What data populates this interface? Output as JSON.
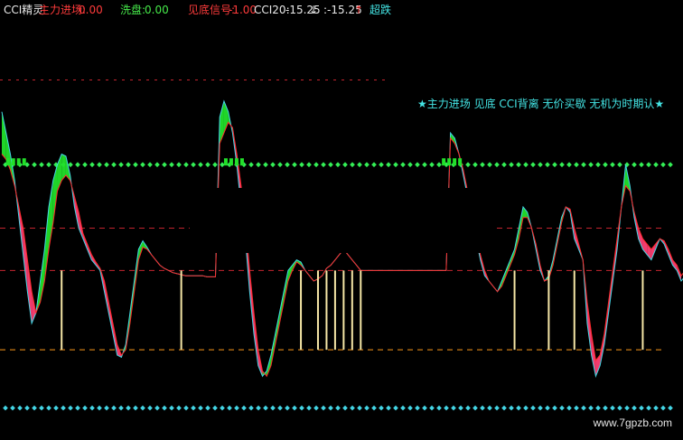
{
  "header": {
    "name": "CCI精灵",
    "main_label": "主力进场:",
    "main_value": "0.00",
    "wash_label": "洗盘:",
    "wash_value": "0.00",
    "bottom_label": "见底信号:",
    "bottom_value": "-1.00",
    "cci_label": "CCI20:",
    "cci_value": "-15.25",
    "cci_arrow": "↓",
    "cci2_value": ":-15.25",
    "cci2_arrow": "↑",
    "oversold": "超跌"
  },
  "banner_text": "★主力进场 见底 CCI背离 无价买歇 无机为时期认★",
  "watermark": "www.7gpzb.com",
  "colors": {
    "background": "#000000",
    "cyan_line": "#44d6e6",
    "red_line": "#ff2a2a",
    "yellow_line": "#f2e28a",
    "up_band": "#ff3f74",
    "down_band": "#22e02a",
    "green_dots": "#33ee55",
    "cyan_dots": "#44d6e6",
    "ref_red": "#c4252f",
    "ref_orange": "#ff9a1a",
    "bars": "#f5e6a6"
  },
  "chart_data": {
    "type": "line",
    "x": [
      0,
      1,
      2,
      3,
      4,
      5,
      6,
      7,
      8,
      9,
      10,
      11,
      12,
      13,
      14,
      15,
      16,
      17,
      18,
      19,
      20,
      21,
      22,
      23,
      24,
      25,
      26,
      27,
      28,
      29,
      30,
      31,
      32,
      33,
      34,
      35,
      36,
      37,
      38,
      39,
      40,
      41,
      42,
      43,
      44,
      45,
      46,
      47,
      48,
      49,
      50,
      51,
      52,
      53,
      54,
      55,
      56,
      57,
      58,
      59,
      60,
      61,
      62,
      63,
      64,
      65,
      66,
      67,
      68,
      69,
      70,
      71,
      72,
      73,
      74,
      75,
      76,
      77,
      78,
      79,
      80,
      81,
      82,
      83,
      84,
      85,
      86,
      87,
      88,
      89,
      90,
      91,
      92,
      93,
      94,
      95,
      96,
      97,
      98,
      99,
      100,
      101,
      102,
      103,
      104,
      105,
      106,
      107,
      108,
      109,
      110,
      111,
      112,
      113,
      114,
      115,
      116,
      117,
      118,
      119,
      120,
      121,
      122,
      123,
      124,
      125,
      126,
      127,
      128,
      129,
      130,
      131,
      132,
      133,
      134,
      135,
      136,
      137,
      138,
      139,
      140,
      141,
      142,
      143,
      144,
      145,
      146,
      147,
      148,
      149,
      150,
      151,
      152,
      153,
      154,
      155,
      156,
      157,
      158,
      159
    ],
    "ylim": [
      -150,
      230
    ],
    "reference_lines": [
      {
        "value": 100,
        "style": "dotted",
        "color": "green"
      },
      {
        "value": 40,
        "style": "dashed",
        "color": "red"
      },
      {
        "value": 0,
        "style": "dashed",
        "color": "red"
      },
      {
        "value": -75,
        "style": "dashed",
        "color": "orange"
      },
      {
        "value": -130,
        "style": "dotted",
        "color": "cyan"
      }
    ],
    "series": [
      {
        "values": [
          150,
          130,
          110,
          85,
          50,
          15,
          -20,
          -50,
          -40,
          -10,
          20,
          60,
          85,
          100,
          110,
          108,
          90,
          60,
          40,
          30,
          20,
          10,
          5,
          0,
          -20,
          -40,
          -60,
          -80,
          -82,
          -70,
          -40,
          -10,
          20,
          28,
          22,
          15,
          10,
          5,
          2,
          0,
          -2,
          -3,
          -4,
          -5,
          -5,
          -5,
          -5,
          -5,
          -6,
          -6,
          -6,
          145,
          160,
          150,
          130,
          100,
          60,
          30,
          -20,
          -60,
          -90,
          -100,
          -95,
          -80,
          -60,
          -40,
          -20,
          0,
          5,
          10,
          8,
          0,
          -5,
          -10,
          -8,
          -5,
          2,
          5,
          10,
          15,
          20,
          15,
          10,
          5,
          0,
          0,
          0,
          0,
          0,
          0,
          0,
          0,
          0,
          0,
          0,
          0,
          0,
          0,
          0,
          0,
          0,
          0,
          0,
          0,
          0,
          130,
          125,
          110,
          90,
          70,
          50,
          30,
          10,
          -5,
          -10,
          -15,
          -20,
          -10,
          0,
          10,
          20,
          40,
          60,
          55,
          40,
          20,
          0,
          -10,
          -5,
          10,
          30,
          50,
          60,
          55,
          30,
          20,
          10,
          -50,
          -80,
          -100,
          -90,
          -70,
          -40,
          -10,
          20,
          60,
          100,
          80,
          50,
          30,
          20,
          15,
          10,
          20,
          30,
          25,
          15,
          5,
          0,
          -10,
          -5,
          0,
          5,
          0,
          -5
        ],
        "color": "cyan_line"
      },
      {
        "values": [
          110,
          105,
          95,
          80,
          60,
          40,
          10,
          -20,
          -40,
          -30,
          -10,
          20,
          45,
          75,
          85,
          90,
          85,
          70,
          55,
          35,
          25,
          15,
          8,
          2,
          -10,
          -30,
          -50,
          -70,
          -80,
          -75,
          -50,
          -20,
          10,
          22,
          20,
          15,
          10,
          5,
          2,
          0,
          -2,
          -3,
          -4,
          -5,
          -5,
          -5,
          -5,
          -5,
          -6,
          -6,
          -6,
          120,
          130,
          140,
          135,
          110,
          80,
          45,
          0,
          -40,
          -75,
          -95,
          -100,
          -90,
          -70,
          -50,
          -30,
          -10,
          0,
          8,
          5,
          0,
          -5,
          -10,
          -8,
          -5,
          2,
          5,
          10,
          15,
          20,
          15,
          10,
          5,
          0,
          0,
          0,
          0,
          0,
          0,
          0,
          0,
          0,
          0,
          0,
          0,
          0,
          0,
          0,
          0,
          0,
          0,
          0,
          0,
          0,
          125,
          120,
          110,
          95,
          75,
          55,
          35,
          15,
          0,
          -10,
          -15,
          -20,
          -15,
          -5,
          5,
          15,
          30,
          50,
          50,
          40,
          25,
          5,
          -10,
          -8,
          5,
          25,
          45,
          60,
          58,
          40,
          25,
          10,
          -30,
          -60,
          -85,
          -80,
          -60,
          -30,
          0,
          30,
          60,
          80,
          75,
          55,
          40,
          30,
          25,
          20,
          25,
          30,
          28,
          20,
          10,
          5,
          -5,
          0,
          5,
          5,
          0,
          -3
        ],
        "color": "red_line"
      }
    ]
  }
}
